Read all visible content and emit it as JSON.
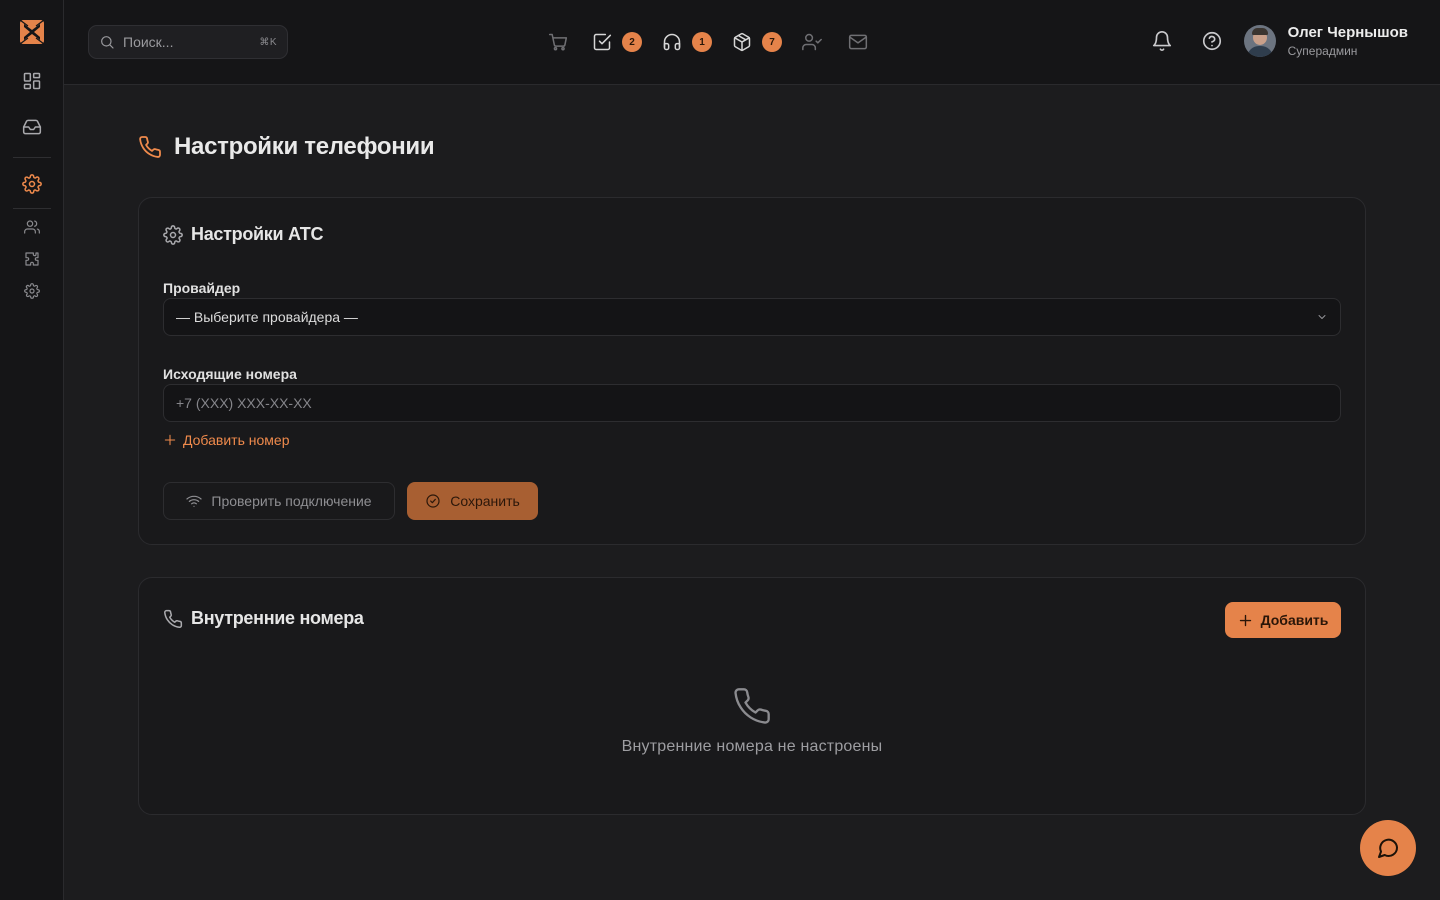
{
  "brand": {
    "accent": "#e5834a",
    "logo_icon": "logo-mark"
  },
  "sidebar": {
    "items": [
      {
        "name": "dashboard",
        "icon": "dashboard-grid-icon"
      },
      {
        "name": "inbox",
        "icon": "inbox-tray-icon"
      },
      {
        "name": "settings",
        "icon": "gear-icon",
        "active": true
      },
      {
        "name": "users",
        "icon": "users-icon"
      },
      {
        "name": "integrations",
        "icon": "puzzle-icon"
      },
      {
        "name": "system-settings",
        "icon": "gear-icon"
      }
    ]
  },
  "header": {
    "search": {
      "placeholder": "Поиск...",
      "shortcut": "⌘K"
    },
    "quick_actions": [
      {
        "icon": "cart-icon",
        "badge": null
      },
      {
        "icon": "checkbox-icon",
        "badge": "2"
      },
      {
        "icon": "headphones-icon",
        "badge": "1"
      },
      {
        "icon": "package-icon",
        "badge": "7"
      },
      {
        "icon": "user-check-icon",
        "badge": null
      },
      {
        "icon": "mail-icon",
        "badge": null
      }
    ],
    "user": {
      "name": "Олег Чернышов",
      "role": "Суперадмин"
    }
  },
  "page": {
    "title": "Настройки телефонии"
  },
  "ats": {
    "title": "Настройки АТС",
    "provider_label": "Провайдер",
    "provider_value": "— Выберите провайдера —",
    "outgoing_label": "Исходящие номера",
    "outgoing_placeholder": "+7 (XXX) XXX-XX-XX",
    "add_number": "Добавить номер",
    "check_button": "Проверить подключение",
    "save_button": "Сохранить"
  },
  "internal": {
    "title": "Внутренние номера",
    "add_button": "Добавить",
    "empty_text": "Внутренние номера не настроены"
  }
}
